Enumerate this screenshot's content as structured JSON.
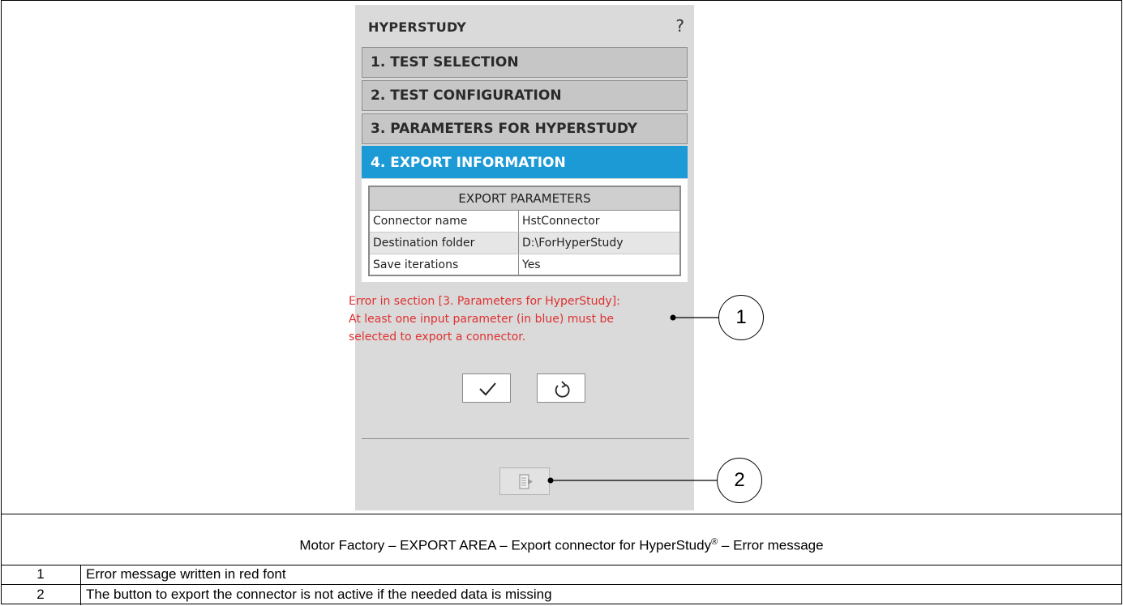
{
  "panel": {
    "title": "HYPERSTUDY",
    "help": "?",
    "sections": [
      {
        "label": "1. TEST SELECTION",
        "active": false
      },
      {
        "label": "2. TEST CONFIGURATION",
        "active": false
      },
      {
        "label": "3. PARAMETERS FOR HYPERSTUDY",
        "active": false
      },
      {
        "label": "4. EXPORT INFORMATION",
        "active": true
      }
    ],
    "active_color": "#1b9ad6",
    "export_parameters": {
      "header": "EXPORT PARAMETERS",
      "rows": [
        {
          "key": "Connector name",
          "value": "HstConnector"
        },
        {
          "key": "Destination folder",
          "value": "D:\\ForHyperStudy"
        },
        {
          "key": "Save iterations",
          "value": "Yes"
        }
      ]
    },
    "error_lines": [
      "Error in section [3. Parameters for HyperStudy]:",
      "At least one input parameter (in blue) must be",
      "selected to export a connector."
    ],
    "error_color": "#e03030",
    "buttons": {
      "validate_icon": "check-icon",
      "reset_icon": "reset-icon",
      "export_icon": "export-connector-icon",
      "export_enabled": false
    }
  },
  "callouts": [
    "1",
    "2"
  ],
  "caption": {
    "text": "Motor Factory – EXPORT AREA – Export connector for HyperStudy",
    "mark": "®",
    "suffix": " – Error message"
  },
  "legend": [
    {
      "num": "1",
      "text": "Error message written in red font"
    },
    {
      "num": "2",
      "text": "The button to export the connector is not active if the needed data is missing"
    }
  ]
}
